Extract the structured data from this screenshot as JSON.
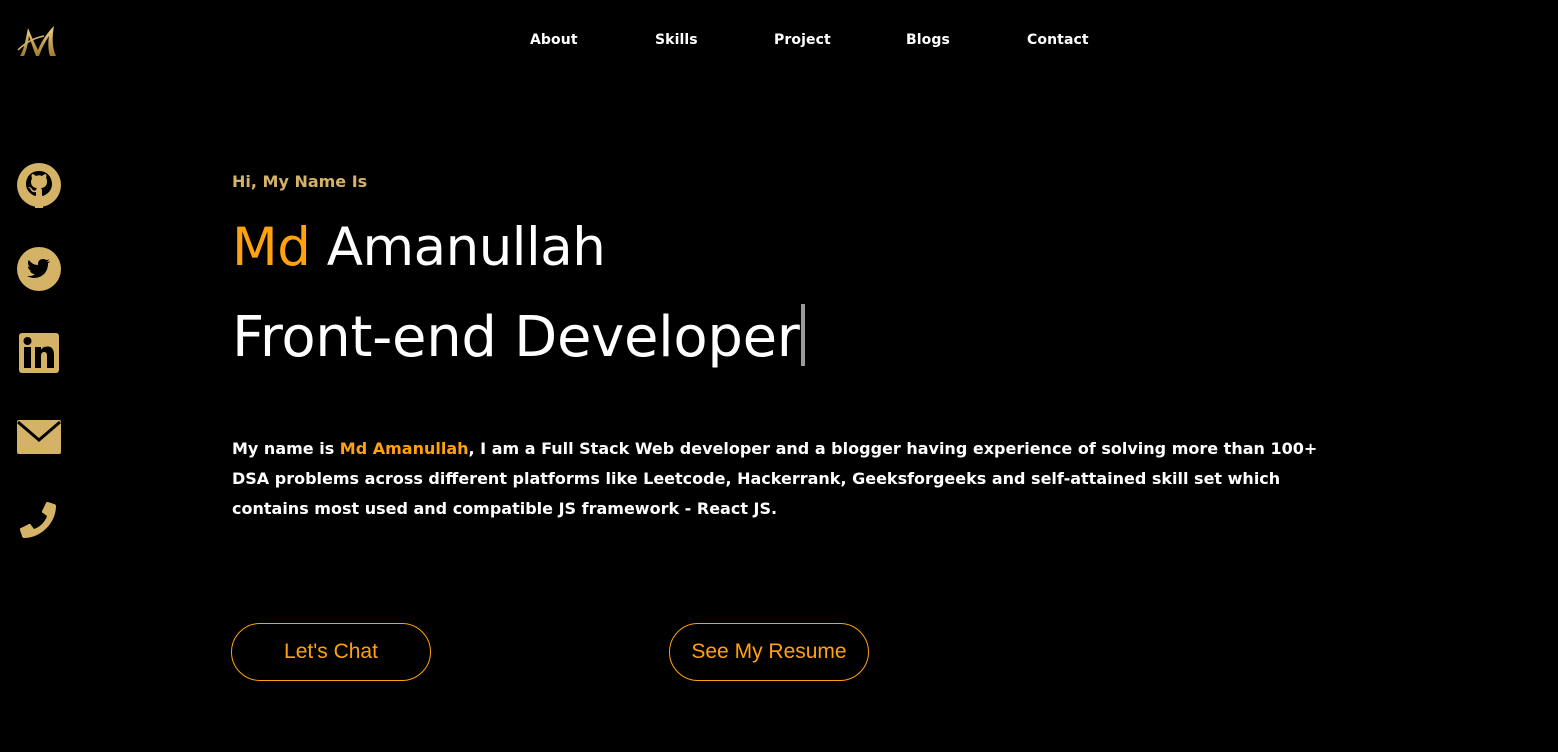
{
  "brand": {
    "logo_text": "M",
    "accent_gold": "#d4b366",
    "accent_orange": "#ffa20d"
  },
  "nav": {
    "items": [
      {
        "label": "About"
      },
      {
        "label": "Skills"
      },
      {
        "label": "Project"
      },
      {
        "label": "Blogs"
      },
      {
        "label": "Contact"
      }
    ]
  },
  "social": {
    "icons": [
      "github-icon",
      "twitter-icon",
      "linkedin-icon",
      "mail-icon",
      "phone-icon"
    ]
  },
  "hero": {
    "greeting": "Hi, My Name Is",
    "name_first": "Md",
    "name_last": "Amanullah",
    "role": "Front-end Developer",
    "bio_prefix": "My name is ",
    "bio_name": "Md Amanullah",
    "bio_rest": ", I am a Full Stack Web developer and a blogger having experience of solving more than 100+ DSA problems across different platforms like Leetcode, Hackerrank, Geeksforgeeks and self-attained skill set which contains most used and compatible JS framework - React JS."
  },
  "buttons": {
    "chat_label": "Let's Chat",
    "resume_label": "See My Resume"
  }
}
